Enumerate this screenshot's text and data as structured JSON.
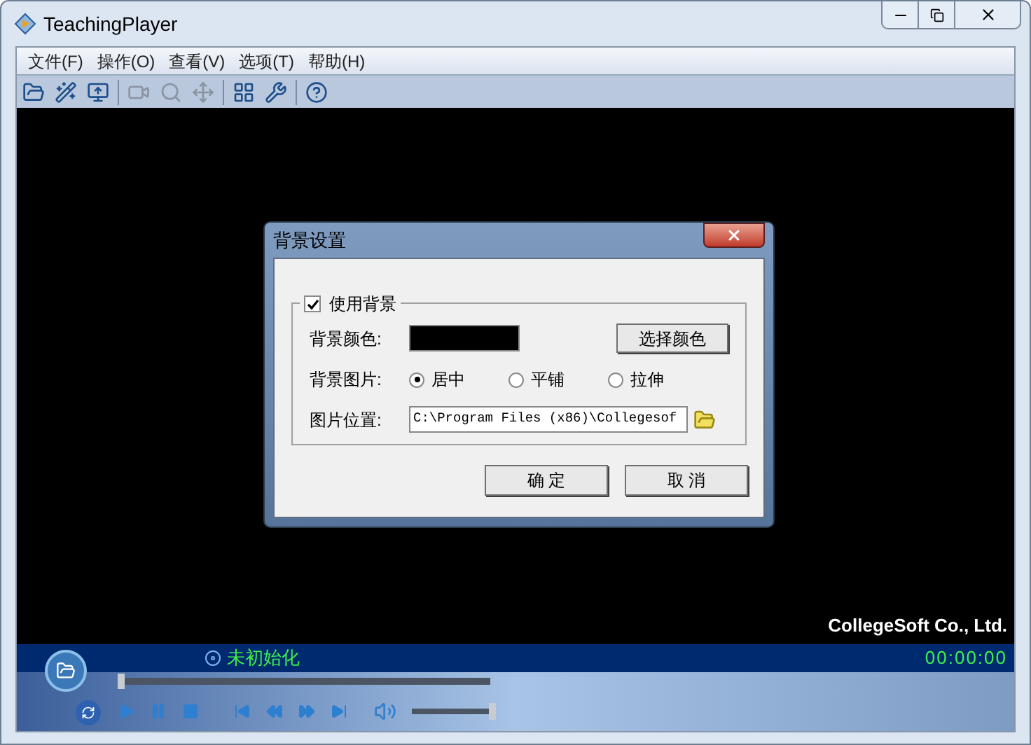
{
  "window": {
    "title": "TeachingPlayer"
  },
  "menu": [
    "文件(F)",
    "操作(O)",
    "查看(V)",
    "选项(T)",
    "帮助(H)"
  ],
  "toolbar": [
    {
      "kind": "open",
      "disabled": false
    },
    {
      "kind": "wand",
      "disabled": false
    },
    {
      "kind": "export",
      "disabled": false
    },
    {
      "kind": "sep"
    },
    {
      "kind": "camera",
      "disabled": true
    },
    {
      "kind": "zoom",
      "disabled": true
    },
    {
      "kind": "move",
      "disabled": true
    },
    {
      "kind": "sep"
    },
    {
      "kind": "palette",
      "disabled": false
    },
    {
      "kind": "tools",
      "disabled": false
    },
    {
      "kind": "sep"
    },
    {
      "kind": "help",
      "disabled": false
    }
  ],
  "video": {
    "brand_text": "CollegeSoft Co., Ltd."
  },
  "status": {
    "text": "未初始化",
    "time": "00:00:00"
  },
  "progress": {
    "level": 0
  },
  "controls": [
    {
      "kind": "play"
    },
    {
      "kind": "pause"
    },
    {
      "kind": "stop"
    },
    {
      "kind": "prev"
    },
    {
      "kind": "rewind"
    },
    {
      "kind": "forward"
    },
    {
      "kind": "next"
    }
  ],
  "volume": {
    "level": 1
  },
  "dialog": {
    "title": "背景设置",
    "use_background": {
      "label": "使用背景",
      "checked": true
    },
    "color_label": "背景颜色:",
    "color": "#000000",
    "choose_color_button": "选择颜色",
    "image_label": "背景图片:",
    "image_modes": [
      {
        "label": "居中",
        "selected": true
      },
      {
        "label": "平铺",
        "selected": false
      },
      {
        "label": "拉伸",
        "selected": false
      }
    ],
    "path_label": "图片位置:",
    "path_value": "C:\\Program Files (x86)\\Collegesof",
    "buttons": [
      "确 定",
      "取 消"
    ]
  }
}
